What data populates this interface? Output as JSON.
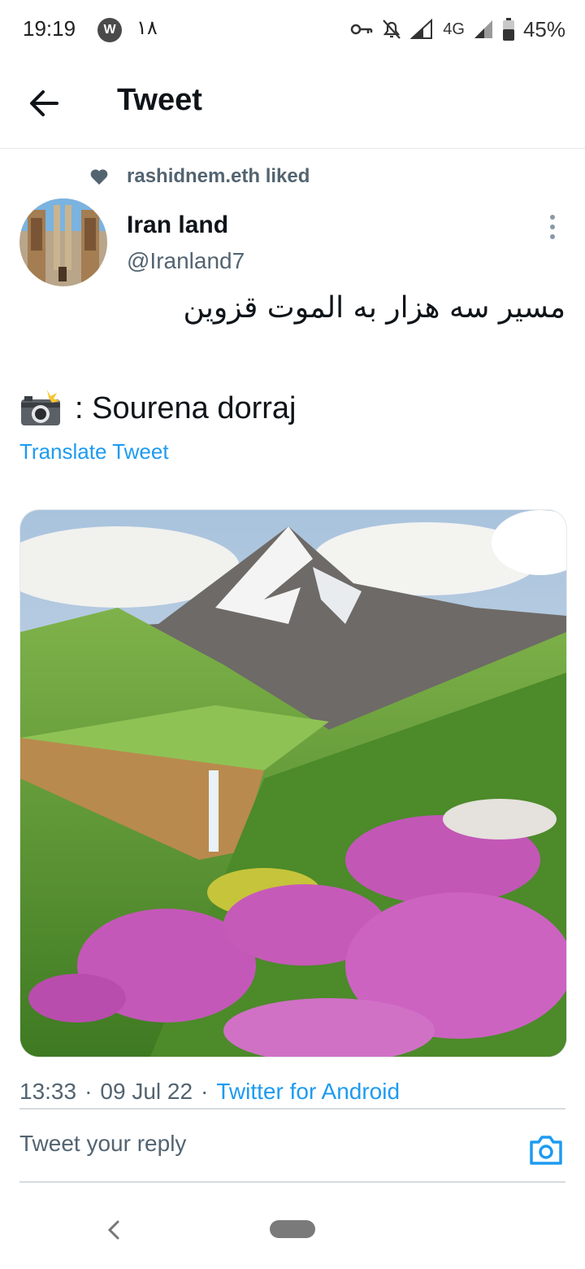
{
  "status_bar": {
    "time": "19:19",
    "app_badge": "W",
    "notification_count": "۱۸",
    "network": "4G",
    "battery_percent": "45%"
  },
  "header": {
    "title": "Tweet"
  },
  "social_context": {
    "text": "rashidnem.eth liked"
  },
  "author": {
    "name": "Iran land",
    "handle": "@Iranland7"
  },
  "tweet": {
    "text_rtl": "مسیر سه هزار به الموت قزوین",
    "credit": ": Sourena dorraj",
    "translate_label": "Translate Tweet"
  },
  "meta": {
    "time": "13:33",
    "date": "09 Jul 22",
    "source": "Twitter for Android",
    "separator": "·"
  },
  "reply": {
    "placeholder": "Tweet your reply"
  },
  "icons": {
    "back": "arrow-left-icon",
    "like": "heart-icon",
    "more": "more-vertical-icon",
    "camera_emoji": "camera-flash-emoji",
    "reply_camera": "camera-icon"
  },
  "colors": {
    "accent": "#1d9bf0",
    "secondary_text": "#536471",
    "primary_text": "#0f1419"
  }
}
